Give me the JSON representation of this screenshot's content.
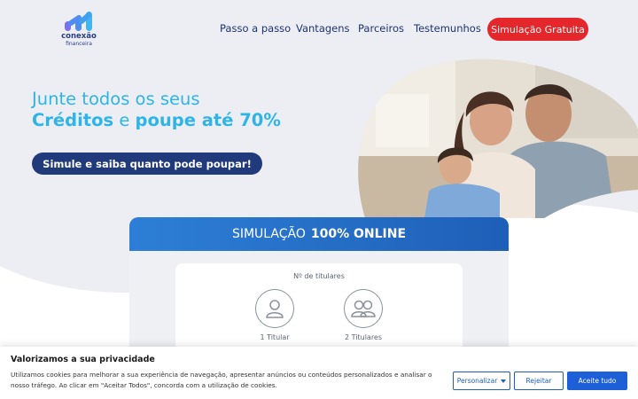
{
  "brand": {
    "name": "conexão",
    "sub": "financeira",
    "colors": {
      "navy": "#203a7c",
      "cyan": "#2fb4e8",
      "red": "#e5262b",
      "blue": "#1e5fb8"
    }
  },
  "nav": {
    "items": [
      {
        "label": "Passo a passo"
      },
      {
        "label": "Vantagens"
      },
      {
        "label": "Parceiros"
      },
      {
        "label": "Testemunhos"
      }
    ],
    "cta": "Simulação Gratuita"
  },
  "hero": {
    "line1": "Junte todos os seus",
    "line2_bold1": "Créditos",
    "line2_mid": " e ",
    "line2_bold2": "poupe até 70%",
    "button": "Simule e saiba quanto pode poupar!",
    "image": "family-photo"
  },
  "simulation": {
    "title_light": "SIMULAÇÃO",
    "title_bold": "100% ONLINE",
    "question": "Nº de titulares",
    "options": [
      {
        "label": "1 Titular",
        "icon": "single-person-icon"
      },
      {
        "label": "2 Titulares",
        "icon": "two-people-icon"
      }
    ]
  },
  "cookies": {
    "title": "Valorizamos a sua privacidade",
    "text": "Utilizamos cookies para melhorar a sua experiência de navegação, apresentar anúncios ou conteúdos personalizados e analisar o nosso tráfego. Ao clicar em \"Aceitar Todos\", concorda com a utilização de cookies.",
    "customize": "Personalizar",
    "reject": "Rejeitar",
    "accept": "Aceite tudo"
  }
}
